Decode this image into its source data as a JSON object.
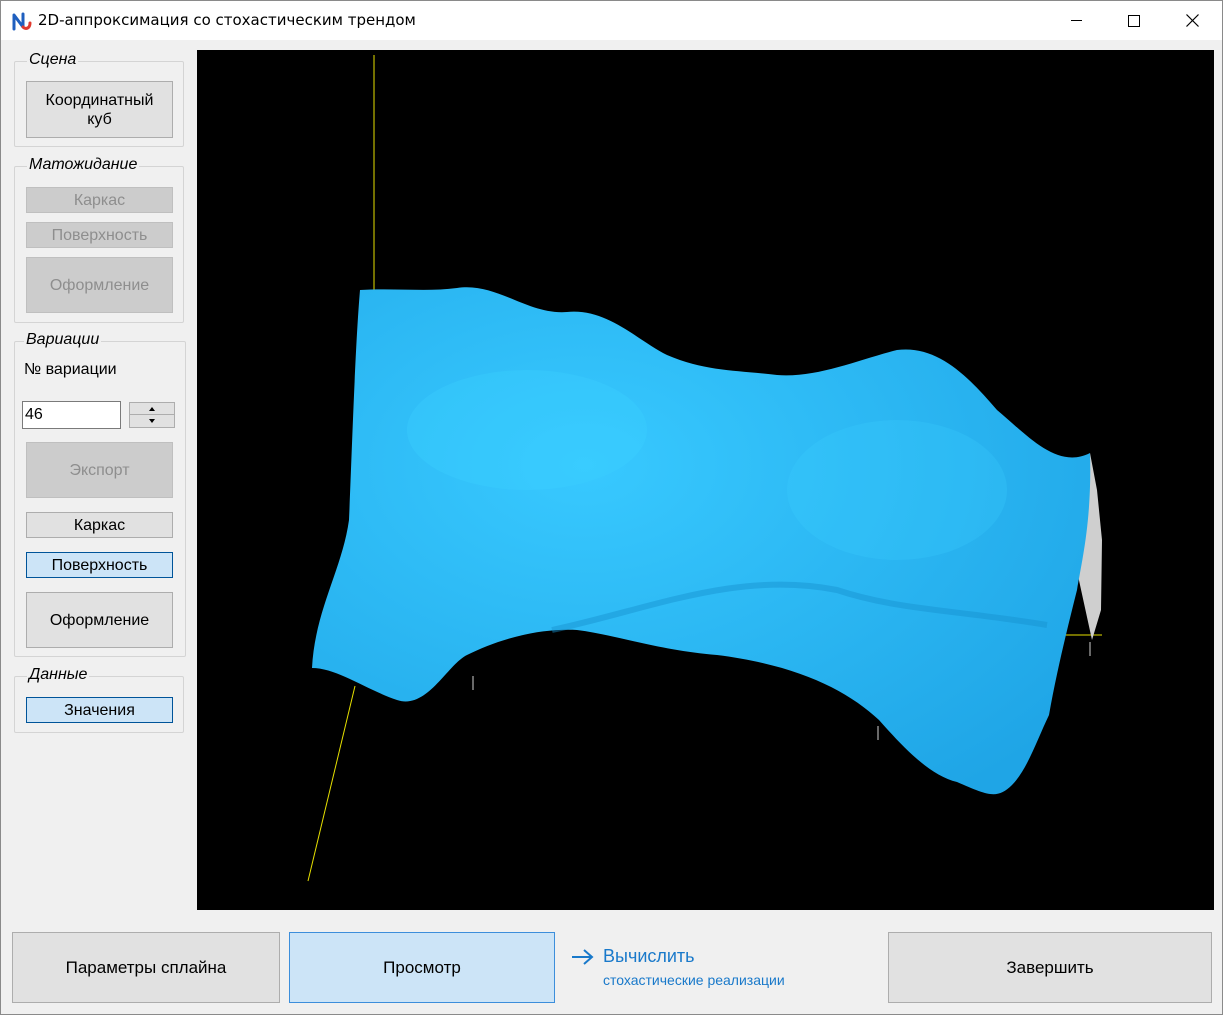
{
  "window": {
    "title": "2D-аппроксимация со стохастическим трендом"
  },
  "scene": {
    "legend": "Сцена",
    "coord_cube_label": "Координатный\nкуб"
  },
  "expectation": {
    "legend": "Матожидание",
    "frame_label": "Каркас",
    "surface_label": "Поверхность",
    "design_label": "Оформление"
  },
  "variations": {
    "legend": "Вариации",
    "number_label": "№ вариации",
    "number_value": "46",
    "export_label": "Экспорт",
    "frame_label": "Каркас",
    "surface_label": "Поверхность",
    "design_label": "Оформление"
  },
  "data_group": {
    "legend": "Данные",
    "values_label": "Значения"
  },
  "bottom": {
    "spline_params_label": "Параметры сплайна",
    "view_label": "Просмотр",
    "compute_label": "Вычислить",
    "compute_sub_label": "стохастические реализации",
    "finish_label": "Завершить"
  },
  "colors": {
    "surface": "#29b8f5",
    "axis": "#e6e000",
    "link": "#1979ca",
    "selected_bg": "#cce4f7"
  },
  "icons": {
    "app": "app-logo-icon",
    "minimize": "minimize-icon",
    "maximize": "maximize-icon",
    "close": "close-icon",
    "arrow": "arrow-right-icon"
  }
}
